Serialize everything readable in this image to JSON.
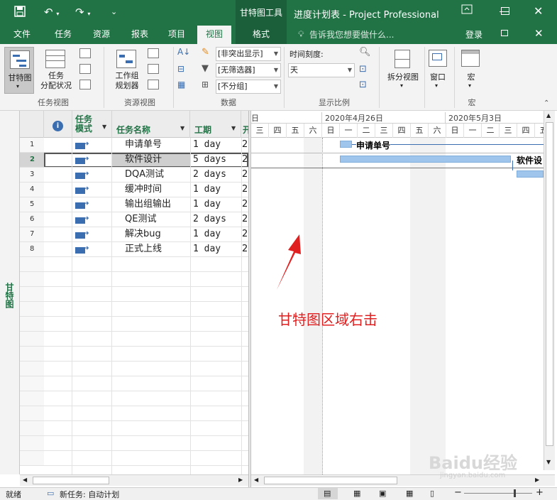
{
  "title_bar": {
    "context_tool_label": "甘特图工具",
    "window_title": "进度计划表 - Project Professional",
    "minimize_icon": "minimize-icon",
    "restore_icon": "restore-icon",
    "close_icon": "close-icon"
  },
  "tabs": [
    {
      "label": "文件"
    },
    {
      "label": "任务"
    },
    {
      "label": "资源"
    },
    {
      "label": "报表"
    },
    {
      "label": "项目"
    },
    {
      "label": "视图"
    },
    {
      "label": "格式"
    }
  ],
  "tell_me": "告诉我您想要做什么...",
  "account": {
    "sign_in": "登录"
  },
  "ribbon": {
    "task_views": {
      "gantt_label": "甘特图",
      "usage_label": "任务\n分配状况",
      "group_label": "任务视图"
    },
    "resource_views": {
      "planner_label": "工作组\n规划器",
      "group_label": "资源视图"
    },
    "data": {
      "highlight_value": "[非突出显示]",
      "filter_value": "[无筛选器]",
      "group_value": "[不分组]",
      "group_label": "数据"
    },
    "zoom": {
      "timescale_label": "时间刻度:",
      "timescale_value": "天",
      "group_label": "显示比例"
    },
    "split_view": {
      "label": "拆分视图"
    },
    "window": {
      "label": "窗口"
    },
    "macros": {
      "label": "宏",
      "group_label": "宏"
    }
  },
  "sidebar": {
    "label": "甘特图"
  },
  "table": {
    "columns": {
      "info_icon": "info-icon",
      "mode": "任务\n模式",
      "name": "任务名称",
      "duration": "工期",
      "start": "开"
    },
    "rows": [
      {
        "id": "1",
        "name": "申请单号",
        "duration": "1 day",
        "start": "2"
      },
      {
        "id": "2",
        "name": "软件设计",
        "duration": "5 days",
        "start": "2"
      },
      {
        "id": "3",
        "name": "DQA测试",
        "duration": "2 days",
        "start": "2"
      },
      {
        "id": "4",
        "name": "缓冲时间",
        "duration": "1 day",
        "start": "2"
      },
      {
        "id": "5",
        "name": "输出组输出",
        "duration": "1 day",
        "start": "2"
      },
      {
        "id": "6",
        "name": "QE测试",
        "duration": "2 days",
        "start": "2"
      },
      {
        "id": "7",
        "name": "解决bug",
        "duration": "1 day",
        "start": "2"
      },
      {
        "id": "8",
        "name": "正式上线",
        "duration": "1 day",
        "start": "2"
      }
    ]
  },
  "gantt": {
    "week_labels": [
      "日",
      "2020年4月26日",
      "2020年5月3日"
    ],
    "day_labels": [
      "三",
      "四",
      "五",
      "六",
      "日",
      "一",
      "二",
      "三",
      "四",
      "五",
      "六",
      "日",
      "一",
      "二",
      "三",
      "四",
      "五"
    ],
    "bar_labels": [
      "申请单号",
      "软件设"
    ]
  },
  "annotation": "甘特图区域右击",
  "statusbar": {
    "ready": "就绪",
    "new_task": "新任务: 自动计划"
  },
  "watermark": "Baidu经验",
  "watermark_url": "jingyan.baidu.com"
}
